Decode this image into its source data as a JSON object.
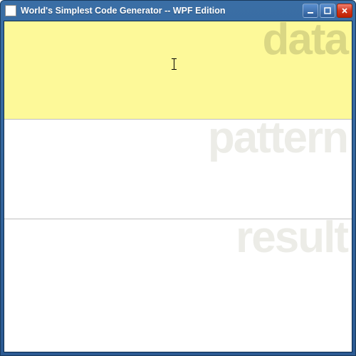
{
  "window": {
    "title": "World's Simplest Code Generator -- WPF Edition"
  },
  "panes": {
    "data": {
      "watermark": "data",
      "value": ""
    },
    "pattern": {
      "watermark": "pattern",
      "value": ""
    },
    "result": {
      "watermark": "result",
      "value": ""
    }
  },
  "colors": {
    "titlebar_gradient_top": "#3a6ea5",
    "titlebar_gradient_bottom": "#2b5a92",
    "data_pane_bg": "#fdf999",
    "close_button": "#d03820"
  }
}
